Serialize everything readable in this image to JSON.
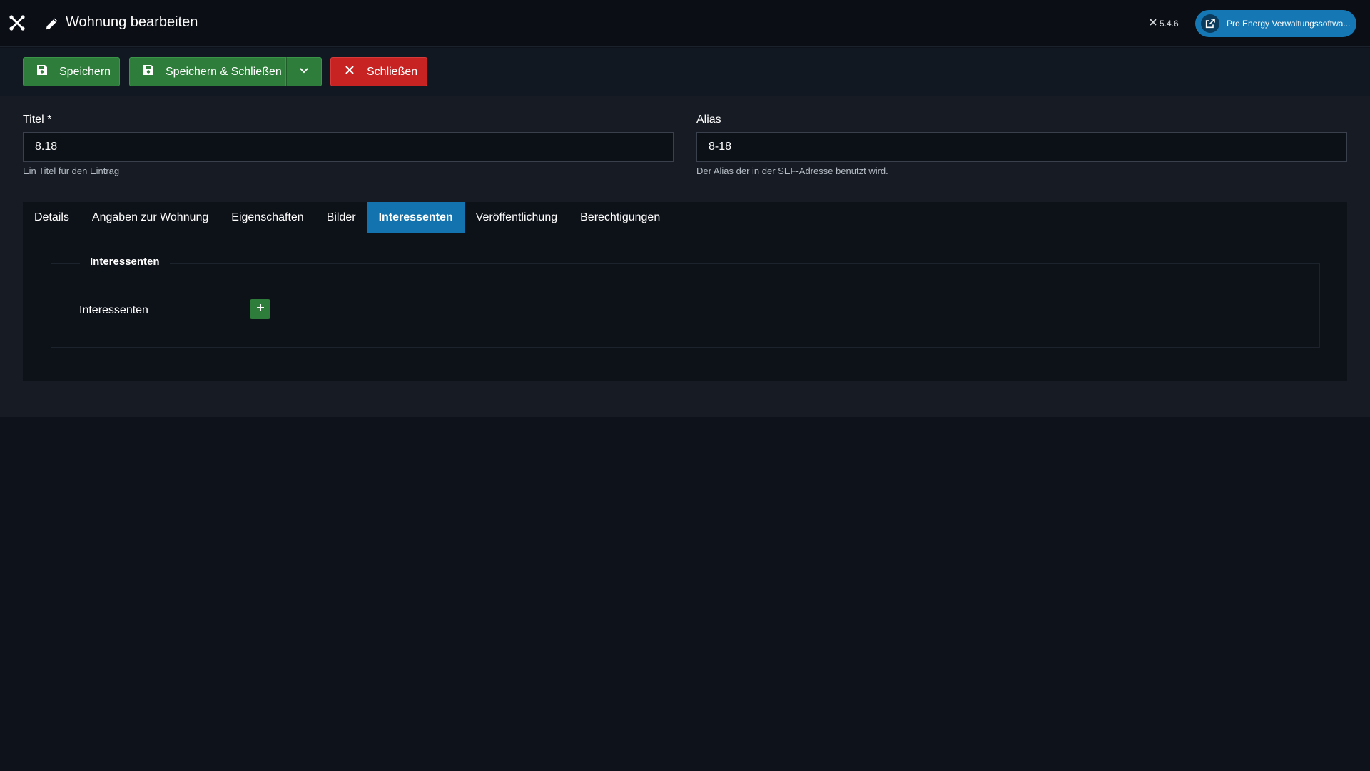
{
  "header": {
    "page_title": "Wohnung bearbeiten",
    "version": "5.4.6",
    "site_button_label": "Pro Energy Verwaltungssoftwa..."
  },
  "toolbar": {
    "save_label": "Speichern",
    "save_close_label": "Speichern & Schließen",
    "close_label": "Schließen"
  },
  "form": {
    "title_label": "Titel *",
    "title_value": "8.18",
    "title_hint": "Ein Titel für den Eintrag",
    "alias_label": "Alias",
    "alias_value": "8-18",
    "alias_hint": "Der Alias der in der SEF-Adresse benutzt wird."
  },
  "tabs": [
    {
      "label": "Details",
      "active": false
    },
    {
      "label": "Angaben zur Wohnung",
      "active": false
    },
    {
      "label": "Eigenschaften",
      "active": false
    },
    {
      "label": "Bilder",
      "active": false
    },
    {
      "label": "Interessenten",
      "active": true
    },
    {
      "label": "Veröffentlichung",
      "active": false
    },
    {
      "label": "Berechtigungen",
      "active": false
    }
  ],
  "panel": {
    "legend": "Interessenten",
    "field_label": "Interessenten"
  },
  "colors": {
    "success": "#2e7d3b",
    "danger": "#c82323",
    "accent": "#1273ae",
    "background": "#0e131b"
  },
  "icons": {
    "logo": "joomla-icon",
    "title": "pencil-icon",
    "save": "floppy-disk-icon",
    "dropdown": "chevron-down-icon",
    "close": "close-icon",
    "external": "external-link-icon",
    "add": "plus-icon"
  }
}
